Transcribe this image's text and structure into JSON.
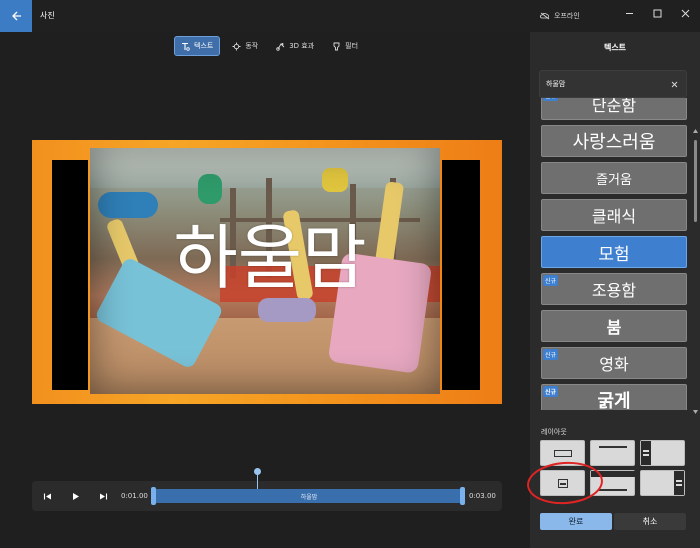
{
  "window": {
    "title": "사진",
    "offline_label": "오프라인"
  },
  "tool_tabs": [
    {
      "label": "텍스트",
      "icon": "text-icon",
      "active": true
    },
    {
      "label": "동작",
      "icon": "motion-icon",
      "active": false
    },
    {
      "label": "3D 효과",
      "icon": "3d-effects-icon",
      "active": false
    },
    {
      "label": "필터",
      "icon": "filter-icon",
      "active": false
    }
  ],
  "canvas": {
    "overlay_text": "하울맘"
  },
  "timeline": {
    "start_time": "0:01.00",
    "end_time": "0:03.00",
    "clip_label": "하울맘"
  },
  "panel": {
    "title": "텍스트",
    "text_input_value": "하울맘",
    "styles": [
      {
        "label": "단순함",
        "new": true,
        "selected": false
      },
      {
        "label": "사랑스러움",
        "new": false,
        "selected": false
      },
      {
        "label": "즐거움",
        "new": false,
        "selected": false
      },
      {
        "label": "클래식",
        "new": false,
        "selected": false
      },
      {
        "label": "모험",
        "new": false,
        "selected": true
      },
      {
        "label": "조용함",
        "new": true,
        "selected": false
      },
      {
        "label": "붐",
        "new": false,
        "selected": false
      },
      {
        "label": "영화",
        "new": true,
        "selected": false
      },
      {
        "label": "굵게",
        "new": true,
        "selected": false
      }
    ],
    "new_badge": "신규",
    "layout_label": "레이아웃",
    "done_label": "완료",
    "cancel_label": "취소"
  },
  "colors": {
    "accent": "#3f7fcf",
    "annotation": "#e02424"
  }
}
